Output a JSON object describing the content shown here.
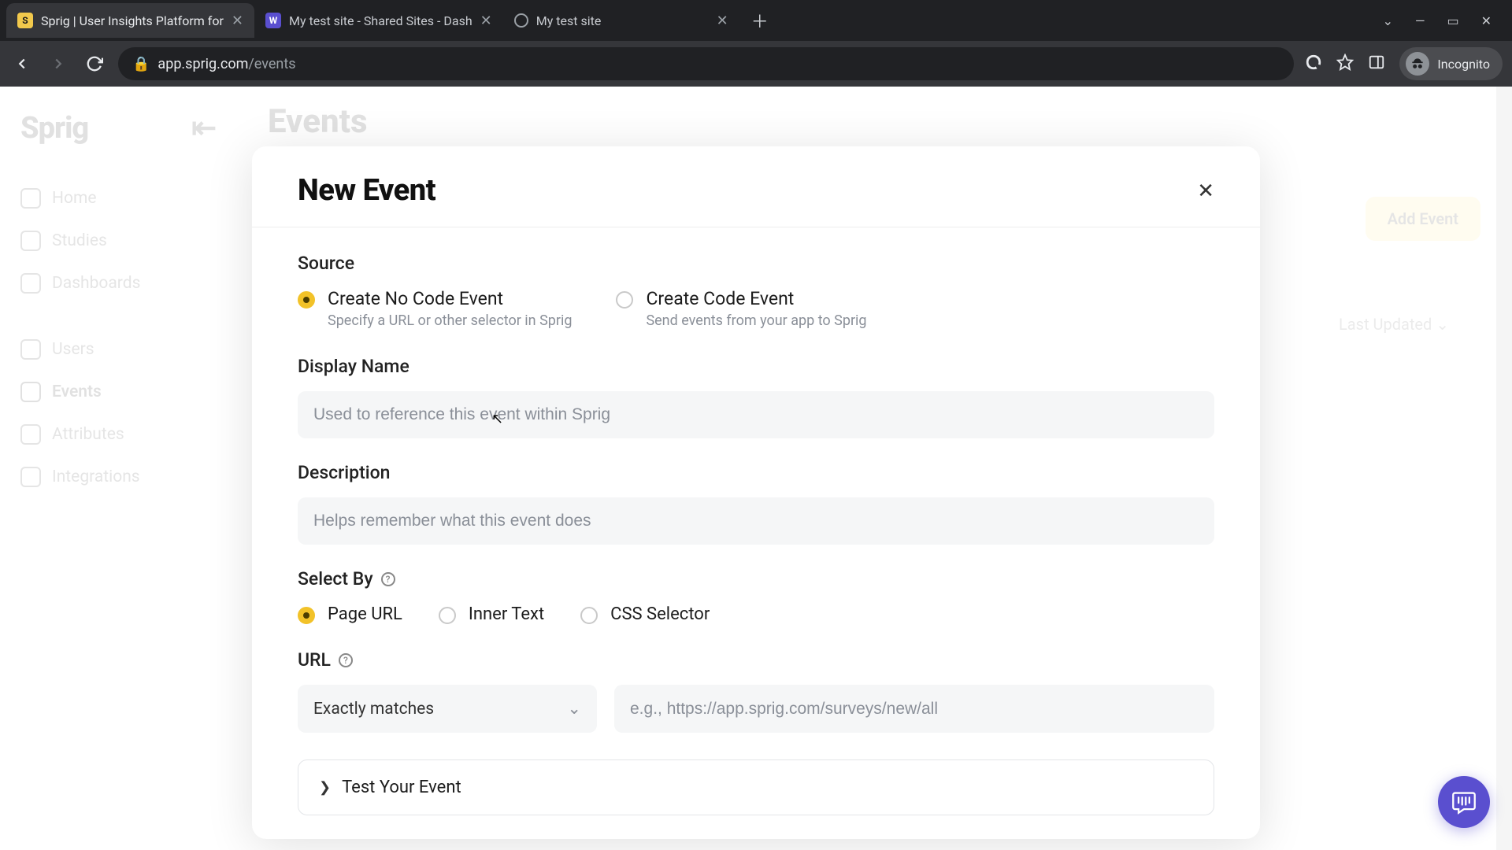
{
  "browser": {
    "tabs": [
      {
        "title": "Sprig | User Insights Platform for",
        "favicon": "S"
      },
      {
        "title": "My test site - Shared Sites - Dash",
        "favicon": "W"
      },
      {
        "title": "My test site",
        "favicon": ""
      }
    ],
    "win_caret": "⌄",
    "win_min": "―",
    "win_max": "▭",
    "win_close": "✕",
    "back": "←",
    "forward": "→",
    "reload": "⟳",
    "lock": "🔒",
    "url_domain": "app.sprig.com",
    "url_path": "/events",
    "ext_ico": "◐",
    "star_ico": "☆",
    "panel_ico": "▣",
    "incognito_label": "Incognito"
  },
  "page": {
    "logo": "Sprig",
    "sidebar": {
      "home": "Home",
      "studies": "Studies",
      "dashboards": "Dashboards",
      "users": "Users",
      "events": "Events",
      "attributes": "Attributes",
      "integrations": "Integrations"
    },
    "title": "Events",
    "add_event": "Add Event",
    "sort": "Last Updated"
  },
  "modal": {
    "title": "New Event",
    "source_label": "Source",
    "source_options": [
      {
        "title": "Create No Code Event",
        "sub": "Specify a URL or other selector in Sprig"
      },
      {
        "title": "Create Code Event",
        "sub": "Send events from your app to Sprig"
      }
    ],
    "display_name_label": "Display Name",
    "display_name_placeholder": "Used to reference this event within Sprig",
    "description_label": "Description",
    "description_placeholder": "Helps remember what this event does",
    "select_by_label": "Select By",
    "select_by_options": {
      "page_url": "Page URL",
      "inner_text": "Inner Text",
      "css_selector": "CSS Selector"
    },
    "url_label": "URL",
    "match_select": "Exactly matches",
    "url_placeholder": "e.g., https://app.sprig.com/surveys/new/all",
    "test_label": "Test Your Event",
    "help_glyph": "?"
  }
}
